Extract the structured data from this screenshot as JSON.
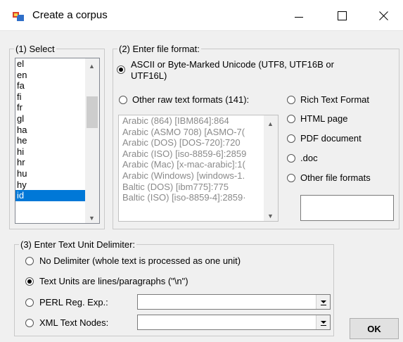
{
  "window": {
    "title": "Create a corpus",
    "icon": "app-window-icon"
  },
  "group1": {
    "legend": "(1) Select",
    "languages": [
      "el",
      "en",
      "fa",
      "fi",
      "fr",
      "gl",
      "ha",
      "he",
      "hi",
      "hr",
      "hu",
      "hy",
      "id"
    ],
    "selected": "id"
  },
  "group2": {
    "legend": "(2) Enter file format:",
    "options": {
      "ascii_line1": "ASCII or Byte-Marked Unicode (UTF8, UTF16B or",
      "ascii_line2": "UTF16L)",
      "other_raw": "Other raw text formats (141):",
      "rtf": "Rich Text Format",
      "html": "HTML page",
      "pdf": "PDF document",
      "doc": ".doc",
      "other_files": "Other file formats"
    },
    "selected_option": "ascii",
    "encodings": [
      "Arabic (864) [IBM864]:864",
      "Arabic (ASMO 708) [ASMO-7(",
      "Arabic (DOS) [DOS-720]:720",
      "Arabic (ISO) [iso-8859-6]:2859",
      "Arabic (Mac) [x-mac-arabic]:1(",
      "Arabic (Windows) [windows-1.",
      "Baltic (DOS) [ibm775]:775",
      "Baltic (ISO) [iso-8859-4]:2859·"
    ]
  },
  "group3": {
    "legend": "(3) Enter Text Unit Delimiter:",
    "options": {
      "none": "No Delimiter (whole text is processed as one unit)",
      "lines": "Text Units are lines/paragraphs (\"\\n\")",
      "perl": "PERL Reg. Exp.:",
      "xml": "XML Text Nodes:"
    },
    "selected_option": "lines"
  },
  "ok_label": "OK"
}
